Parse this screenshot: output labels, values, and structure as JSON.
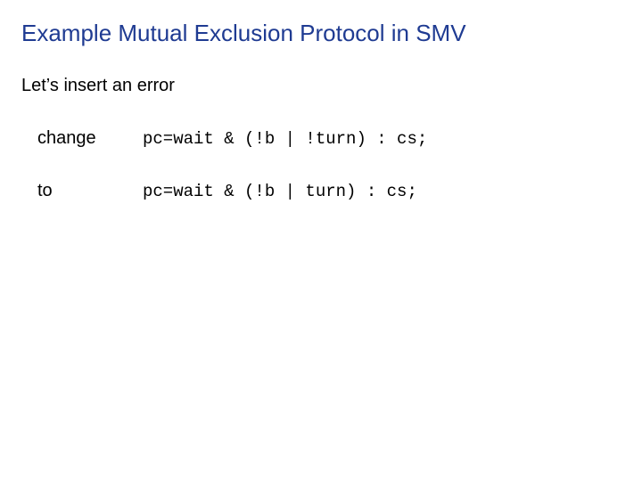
{
  "title": "Example Mutual Exclusion Protocol in SMV",
  "subtitle": "Let’s insert an error",
  "rows": [
    {
      "label": "change",
      "code": "pc=wait & (!b | !turn) : cs;"
    },
    {
      "label": "to",
      "code": "pc=wait & (!b | turn) : cs;"
    }
  ]
}
